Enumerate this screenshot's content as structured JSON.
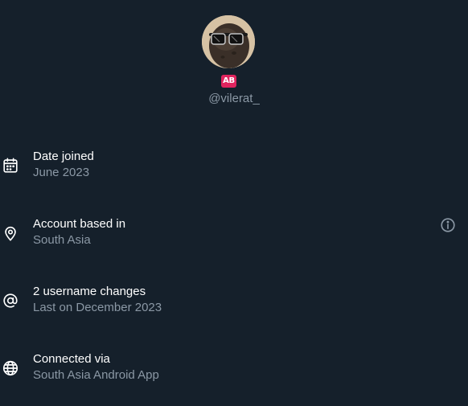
{
  "profile": {
    "badge_text": "AB",
    "handle": "@vilerat_"
  },
  "rows": [
    {
      "icon": "calendar-icon",
      "title": "Date joined",
      "subtitle": "June 2023"
    },
    {
      "icon": "location-pin-icon",
      "title": "Account based in",
      "subtitle": "South Asia",
      "action_icon": "info-icon"
    },
    {
      "icon": "at-sign-icon",
      "title": "2 username changes",
      "subtitle": "Last on December 2023"
    },
    {
      "icon": "globe-icon",
      "title": "Connected via",
      "subtitle": "South Asia Android App"
    }
  ],
  "colors": {
    "background": "#15202b",
    "primary_text": "#ffffff",
    "secondary_text": "#8b98a5",
    "badge": "#e0245e"
  }
}
